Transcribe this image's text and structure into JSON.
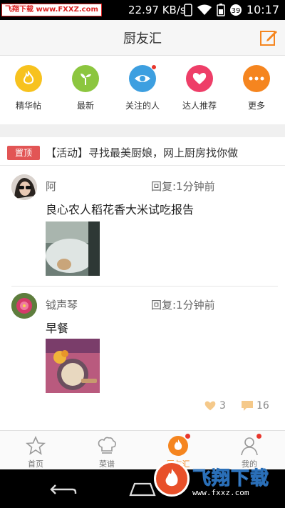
{
  "statusbar": {
    "watermark": "飞翔下载 www.FXXZ.com",
    "speed": "22.97 KB/s",
    "time": "10:17",
    "icons": [
      "sim-icon",
      "wifi-icon",
      "battery-icon",
      "data-saver-icon"
    ]
  },
  "header": {
    "title": "厨友汇",
    "edit_icon": "edit-icon"
  },
  "categories": [
    {
      "label": "精华帖",
      "icon": "flame-icon",
      "color": "#f7c21e"
    },
    {
      "label": "最新",
      "icon": "sprout-icon",
      "color": "#8cc63f"
    },
    {
      "label": "关注的人",
      "icon": "eye-icon",
      "color": "#3d9fe0",
      "badge": true
    },
    {
      "label": "达人推荐",
      "icon": "heart-icon",
      "color": "#ee3e68"
    },
    {
      "label": "更多",
      "icon": "more-icon",
      "color": "#f5851f"
    }
  ],
  "pinned": {
    "badge": "置顶",
    "text": "【活动】寻找最美厨娘，网上厨房找你做"
  },
  "posts": [
    {
      "author": "阿",
      "reply": "回复:1分钟前",
      "title": "良心农人稻花香大米试吃报告"
    },
    {
      "author": "钺声琴",
      "reply": "回复:1分钟前",
      "title": "早餐",
      "likes": "3",
      "comments": "16"
    }
  ],
  "tabs": [
    {
      "label": "首页",
      "icon": "star-icon"
    },
    {
      "label": "菜谱",
      "icon": "chef-hat-icon"
    },
    {
      "label": "厨友汇",
      "icon": "flame-icon",
      "active": true,
      "badge": true
    },
    {
      "label": "我的",
      "icon": "person-icon",
      "badge": true
    }
  ],
  "nav": {
    "back_icon": "back-icon",
    "home_icon": "home-icon"
  },
  "watermark_bottom": {
    "text": "飞翔下载",
    "url": "www.fxxz.com"
  },
  "colors": {
    "accent": "#f5851f",
    "pin_red": "#e25555"
  }
}
